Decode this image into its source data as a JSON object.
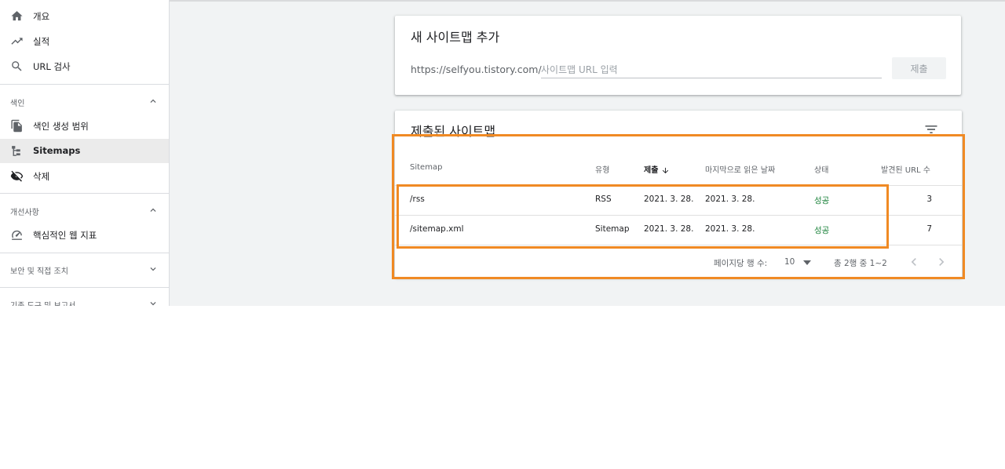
{
  "sidebar": {
    "items": [
      {
        "label": "개요",
        "icon": "home-icon"
      },
      {
        "label": "실적",
        "icon": "trending-up-icon"
      },
      {
        "label": "URL 검사",
        "icon": "search-icon"
      }
    ],
    "sections": [
      {
        "label": "색인",
        "expanded": true,
        "items": [
          {
            "label": "색인 생성 범위",
            "icon": "copy-icon"
          },
          {
            "label": "Sitemaps",
            "icon": "sitemap-icon",
            "active": true
          },
          {
            "label": "삭제",
            "icon": "eye-off-icon"
          }
        ]
      },
      {
        "label": "개선사항",
        "expanded": true,
        "items": [
          {
            "label": "핵심적인 웹 지표",
            "icon": "speedometer-icon"
          }
        ]
      },
      {
        "label": "보안 및 직접 조치",
        "expanded": false
      },
      {
        "label": "기존 도구 및 보고서",
        "expanded": false
      }
    ]
  },
  "add_sitemap": {
    "title": "새 사이트맵 추가",
    "url_prefix": "https://selfyou.tistory.com/",
    "input_value": "",
    "input_placeholder": "사이트맵 URL 입력",
    "submit_label": "제출"
  },
  "submitted": {
    "title": "제출된 사이트맵",
    "columns": [
      "Sitemap",
      "유형",
      "제출",
      "마지막으로 읽은 날짜",
      "상태",
      "발견된 URL 수"
    ],
    "sorted_column": "제출",
    "rows": [
      {
        "sitemap": "/rss",
        "type": "RSS",
        "submitted": "2021. 3. 28.",
        "last_read": "2021. 3. 28.",
        "status": "성공",
        "urls": "3"
      },
      {
        "sitemap": "/sitemap.xml",
        "type": "Sitemap",
        "submitted": "2021. 3. 28.",
        "last_read": "2021. 3. 28.",
        "status": "성공",
        "urls": "7"
      }
    ],
    "pagination": {
      "rows_per_page_label": "페이지당 행 수:",
      "rows_per_page": "10",
      "range": "총 2행 중 1~2"
    }
  },
  "colors": {
    "highlight": "#f08a24",
    "success": "#188038",
    "active_nav": "#ebebeb"
  }
}
